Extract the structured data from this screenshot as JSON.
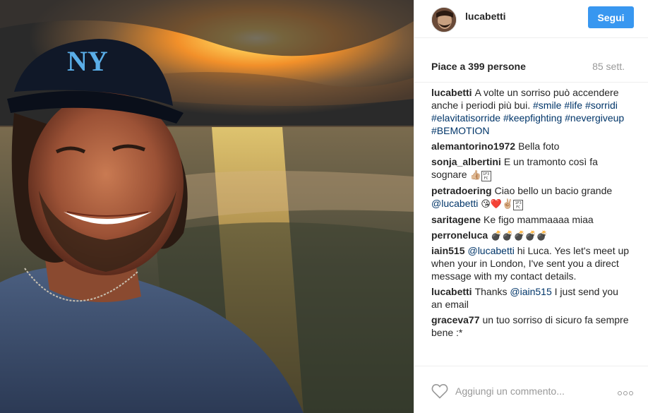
{
  "post": {
    "photo_icon": "sunset-selfie-photo",
    "cap_logo": "NY"
  },
  "header": {
    "username": "lucabetti",
    "follow_label": "Segui",
    "accent_color": "#3897f0"
  },
  "stats": {
    "likes": "Piace a 399 persone",
    "age": "85 sett."
  },
  "caption": {
    "user": "lucabetti",
    "text": "A volte un sorriso può accendere anche i periodi più bui.",
    "hashtags": [
      "#smile",
      "#life",
      "#sorridi",
      "#elavitatisorride",
      "#keepfighting",
      "#nevergiveup",
      "#BEMOTION"
    ]
  },
  "comments": [
    {
      "user": "alemantorino1972",
      "text": "Bella foto"
    },
    {
      "user": "sonja_albertini",
      "text": "E un tramonto così fa sognare",
      "emoji": "👍🏼",
      "box": "1F3FC"
    },
    {
      "user": "petradoering",
      "text": "Ciao bello un bacio grande",
      "mention": "@lucabetti",
      "emoji": "😘❤️✌🏼",
      "box": "1F3FC"
    },
    {
      "user": "saritagene",
      "text": "Ke figo mammaaaa miaa"
    },
    {
      "user": "perroneluca",
      "emoji": "💣💣💣💣💣"
    },
    {
      "user": "iain515",
      "mention": "@lucabetti",
      "text": "hi Luca. Yes let's meet up when your in London, I've sent you a direct message with my contact details."
    },
    {
      "user": "lucabetti",
      "text_a": "Thanks",
      "mention": "@iain515",
      "text_b": "I just send you an email"
    },
    {
      "user": "graceva77",
      "text": "un tuo sorriso di sicuro fa sempre bene :*"
    }
  ],
  "footer": {
    "heart_icon": "heart-icon",
    "comment_placeholder": "Aggiungi un commento...",
    "more_icon": "more-options-icon"
  }
}
